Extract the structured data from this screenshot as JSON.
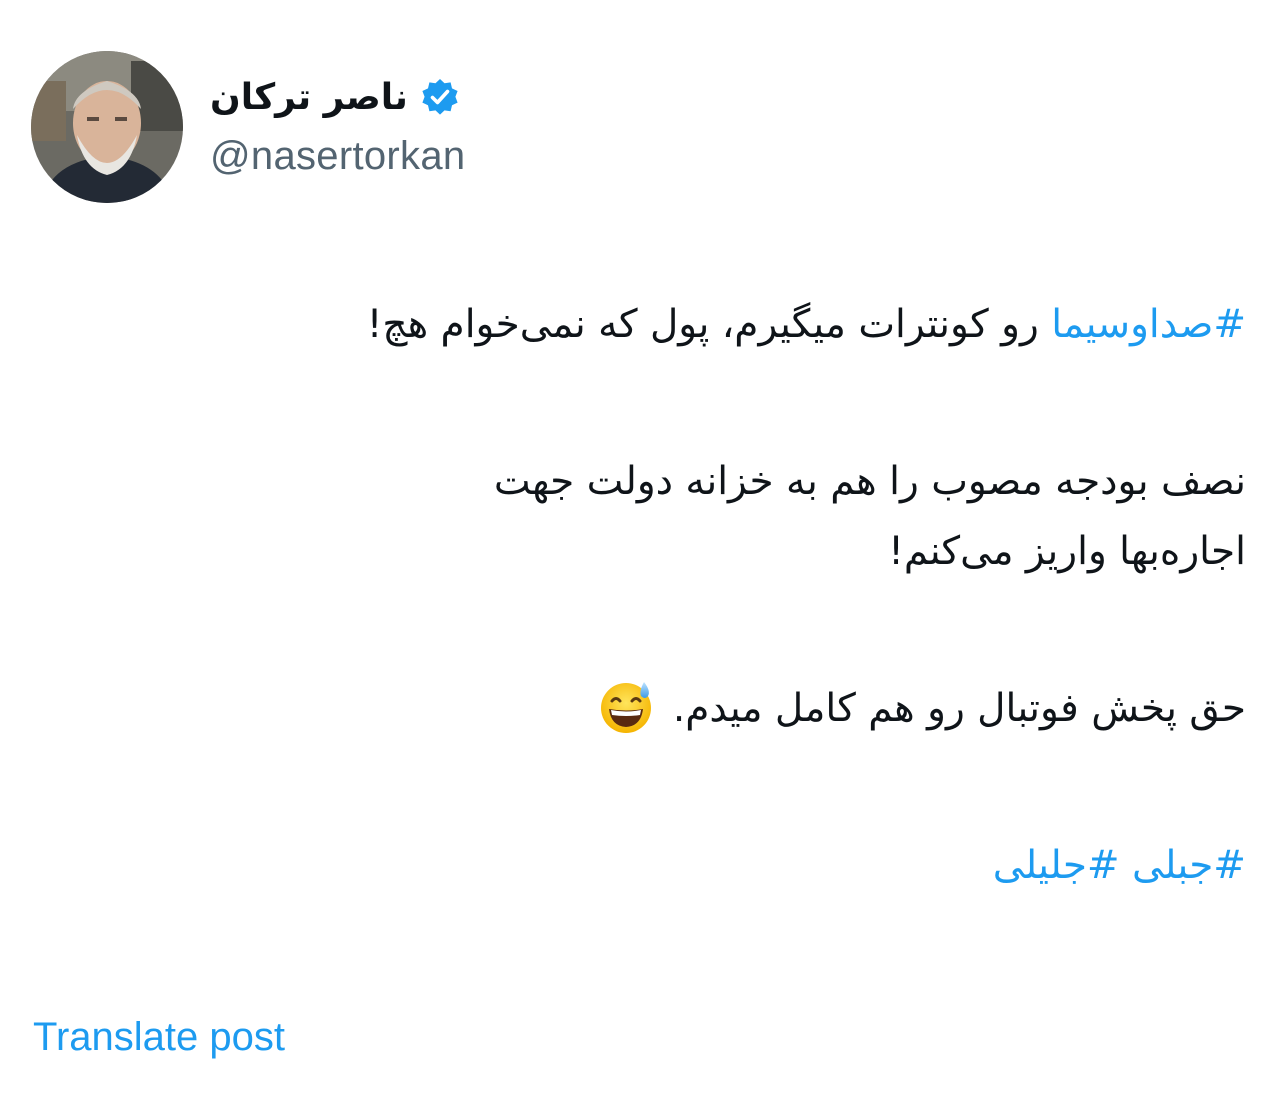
{
  "author": {
    "display_name": "ناصر ترکان",
    "handle": "@nasertorkan",
    "avatar_icon": "profile-photo",
    "verified_icon": "verified-badge-icon",
    "verified_color": "#1d9bf0"
  },
  "post": {
    "line1_hashtag": "#صداوسیما",
    "line1_text": " رو کونترات میگیرم، پول که نمی‌خوام هچ!",
    "line2_text": "نصف بودجه مصوب را هم به خزانه دولت جهت",
    "line3_text": "اجاره‌بها واریز می‌کنم!",
    "line4_text": "حق پخش فوتبال رو هم کامل میدم. ",
    "line4_emoji": "grinning-face-with-sweat-emoji",
    "hashtag_a": "#جبلی",
    "hashtag_b": "#جلیلی"
  },
  "actions": {
    "translate_label": "Translate post"
  },
  "colors": {
    "link": "#1d9bf0",
    "text": "#0f1419",
    "secondary": "#536471"
  }
}
